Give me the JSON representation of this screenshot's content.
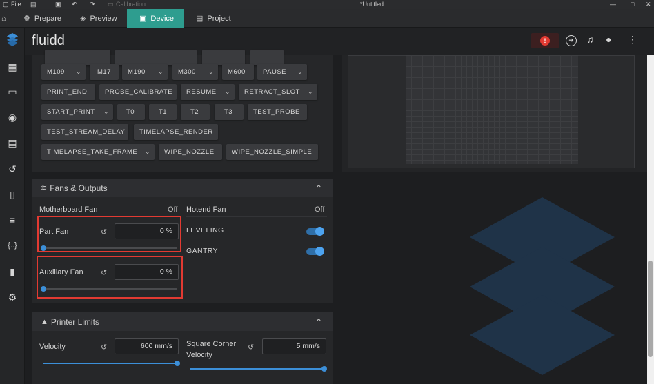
{
  "titlebar": {
    "file": "File",
    "doc_title": "*Untitled",
    "faint_label": "Calibration",
    "minimize": "—",
    "maximize": "□",
    "close": "✕"
  },
  "tabs": [
    {
      "label": "Prepare"
    },
    {
      "label": "Preview"
    },
    {
      "label": "Device"
    },
    {
      "label": "Project"
    }
  ],
  "app": {
    "brand": "fluidd"
  },
  "macros": {
    "row1": [
      "M109",
      "M17",
      "M190",
      "M300",
      "M600",
      "PAUSE"
    ],
    "row2": [
      "PRINT_END",
      "PROBE_CALIBRATE",
      "RESUME",
      "RETRACT_SLOT"
    ],
    "row3": [
      "START_PRINT",
      "T0",
      "T1",
      "T2",
      "T3",
      "TEST_PROBE"
    ],
    "row4": [
      "TEST_STREAM_DELAY",
      "TIMELAPSE_RENDER"
    ],
    "row5": [
      "TIMELAPSE_TAKE_FRAME",
      "WIPE_NOZZLE",
      "WIPE_NOZZLE_SIMPLE"
    ]
  },
  "fans": {
    "title": "Fans & Outputs",
    "motherboard_fan": {
      "label": "Motherboard Fan",
      "value": "Off"
    },
    "hotend_fan": {
      "label": "Hotend Fan",
      "value": "Off"
    },
    "part_fan": {
      "label": "Part Fan",
      "value": "0 %",
      "level": 0
    },
    "auxiliary_fan": {
      "label": "Auxiliary Fan",
      "value": "0 %",
      "level": 0
    },
    "leveling": {
      "label": "LEVELING",
      "on": true
    },
    "gantry": {
      "label": "GANTRY",
      "on": true
    }
  },
  "limits": {
    "title": "Printer Limits",
    "velocity": {
      "label": "Velocity",
      "value": "600 mm/s",
      "level": 1.0
    },
    "square_corner": {
      "label_line1": "Square Corner",
      "label_line2": "Velocity",
      "value": "5 mm/s",
      "level": 1.0
    }
  },
  "colors": {
    "accent": "#3c8fd8",
    "tab_active": "#2e9d8f",
    "highlight": "#e23a32",
    "alert": "#e23a32"
  }
}
